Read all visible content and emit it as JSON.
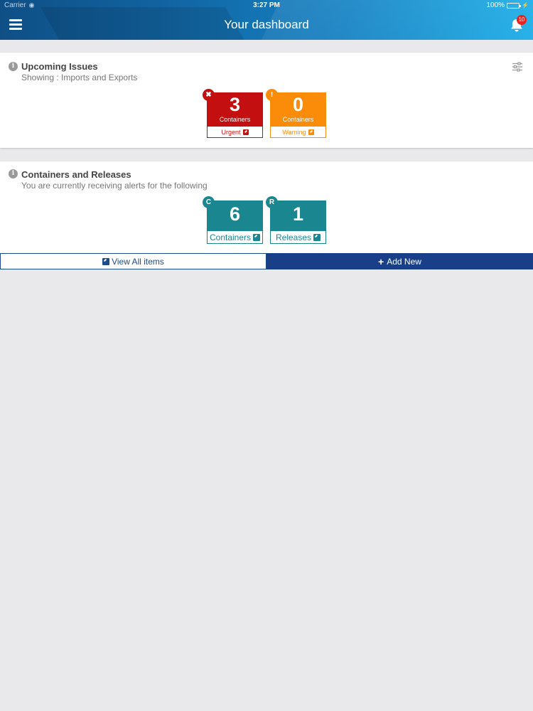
{
  "status_bar": {
    "carrier": "Carrier",
    "time": "3:27 PM",
    "battery": "100%"
  },
  "header": {
    "title": "Your dashboard",
    "notifications": "10"
  },
  "upcoming": {
    "title": "Upcoming Issues",
    "subtitle": "Showing : Imports and Exports",
    "tiles": [
      {
        "count": "3",
        "caption": "Containers",
        "link": "Urgent",
        "corner": "✖"
      },
      {
        "count": "0",
        "caption": "Containers",
        "link": "Warning",
        "corner": "!"
      }
    ]
  },
  "containers": {
    "title": "Containers and Releases",
    "subtitle": "You are currently receiving alerts for the following",
    "tiles": [
      {
        "count": "6",
        "link": "Containers",
        "corner": "C"
      },
      {
        "count": "1",
        "link": "Releases",
        "corner": "R"
      }
    ]
  },
  "actions": {
    "view_all": "View All items",
    "add_new": "Add New"
  },
  "colors": {
    "urgent": "#c30f0f",
    "warning": "#fa8c0a",
    "teal": "#1a8690",
    "navy": "#183f87"
  }
}
